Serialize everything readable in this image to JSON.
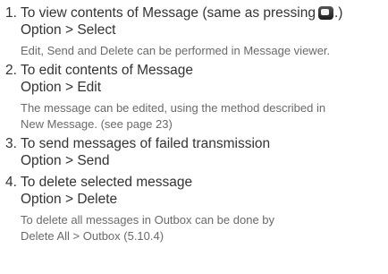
{
  "items": [
    {
      "number": "1.",
      "title": "To view contents of Message (same as pressing",
      "title_suffix": ".)",
      "key_icon": "select-key-icon",
      "action": "Option > Select",
      "notes": [
        "Edit, Send and Delete can be performed in Message viewer."
      ]
    },
    {
      "number": "2.",
      "title": "To edit contents of Message",
      "action": "Option > Edit",
      "notes": [
        "The message can be edited, using the method described in",
        "New Message. (see page 23)"
      ]
    },
    {
      "number": "3.",
      "title": "To send messages of failed transmission",
      "action": "Option > Send",
      "notes": []
    },
    {
      "number": "4.",
      "title": "To delete selected message",
      "action": "Option > Delete",
      "notes": [
        "To delete all messages in Outbox can be done by",
        "Delete All > Outbox (5.10.4)"
      ]
    }
  ]
}
